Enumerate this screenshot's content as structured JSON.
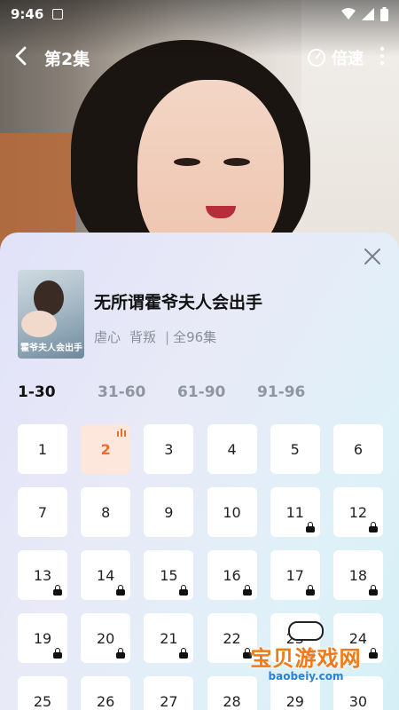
{
  "status_bar": {
    "time": "9:46"
  },
  "top_bar": {
    "episode_title": "第2集",
    "speed_label": "倍速"
  },
  "drama": {
    "title": "无所谓霍爷夫人会出手",
    "tags": [
      "虐心",
      "背叛"
    ],
    "total": "全96集",
    "poster_text": "霍爷夫人会出手"
  },
  "ranges": [
    {
      "label": "1-30",
      "active": true
    },
    {
      "label": "31-60",
      "active": false
    },
    {
      "label": "61-90",
      "active": false
    },
    {
      "label": "91-96",
      "active": false
    }
  ],
  "episodes": [
    {
      "n": "1",
      "locked": false
    },
    {
      "n": "2",
      "locked": false,
      "playing": true
    },
    {
      "n": "3",
      "locked": false
    },
    {
      "n": "4",
      "locked": false
    },
    {
      "n": "5",
      "locked": false
    },
    {
      "n": "6",
      "locked": false
    },
    {
      "n": "7",
      "locked": false
    },
    {
      "n": "8",
      "locked": false
    },
    {
      "n": "9",
      "locked": false
    },
    {
      "n": "10",
      "locked": false
    },
    {
      "n": "11",
      "locked": true
    },
    {
      "n": "12",
      "locked": true
    },
    {
      "n": "13",
      "locked": true
    },
    {
      "n": "14",
      "locked": true
    },
    {
      "n": "15",
      "locked": true
    },
    {
      "n": "16",
      "locked": true
    },
    {
      "n": "17",
      "locked": true
    },
    {
      "n": "18",
      "locked": true
    },
    {
      "n": "19",
      "locked": true
    },
    {
      "n": "20",
      "locked": true
    },
    {
      "n": "21",
      "locked": true
    },
    {
      "n": "22",
      "locked": true
    },
    {
      "n": "23",
      "locked": true
    },
    {
      "n": "24",
      "locked": true
    },
    {
      "n": "25",
      "locked": true
    },
    {
      "n": "26",
      "locked": true
    },
    {
      "n": "27",
      "locked": true
    },
    {
      "n": "28",
      "locked": true
    },
    {
      "n": "29",
      "locked": true
    },
    {
      "n": "30",
      "locked": true
    }
  ],
  "watermark": {
    "title": "宝贝游戏网",
    "url": "baobeiy.com"
  },
  "colors": {
    "accent": "#ee6b2d",
    "playing_bg": "#fde6dc"
  }
}
